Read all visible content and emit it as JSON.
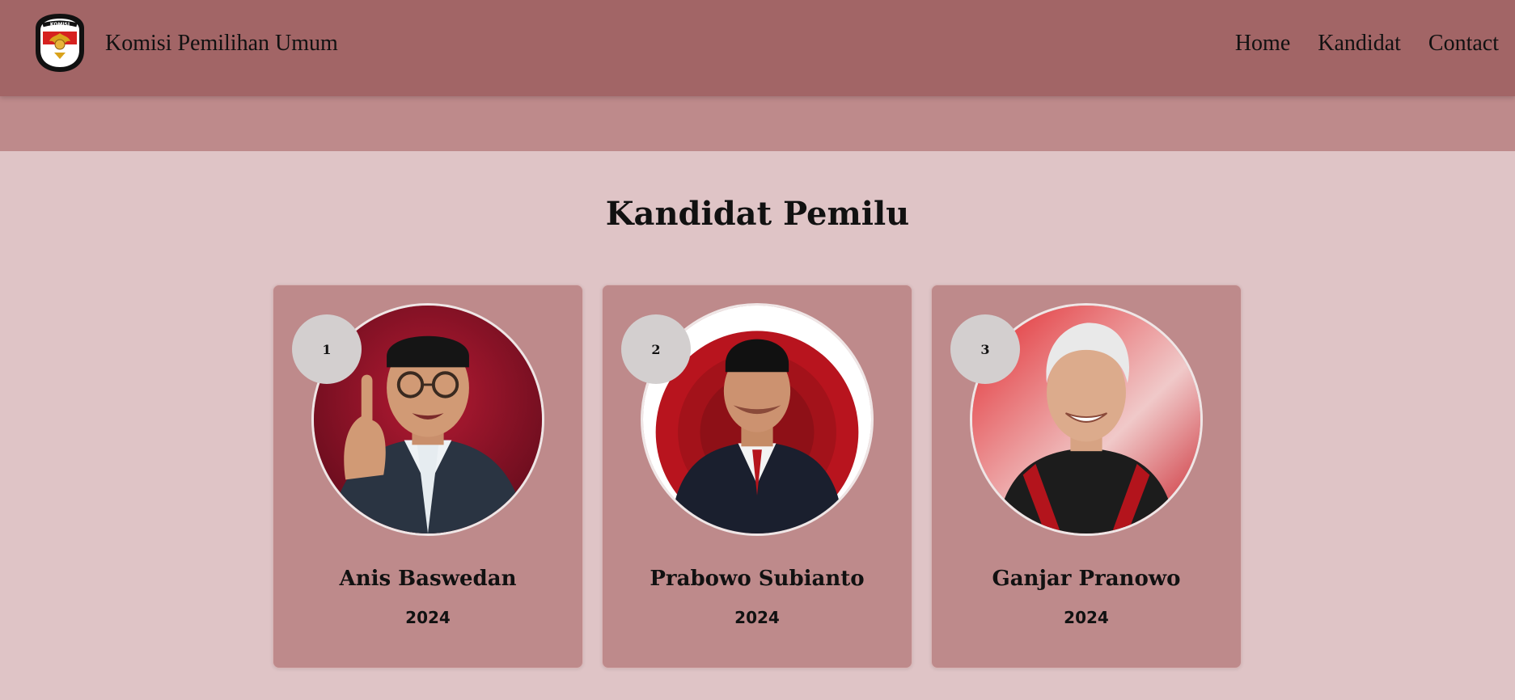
{
  "header": {
    "brand": "Komisi Pemilihan Umum",
    "logo": {
      "name": "kpu-logo",
      "top_text": "KOMISI",
      "bottom_text": "PEMILIHAN UMUM"
    },
    "nav": [
      {
        "label": "Home"
      },
      {
        "label": "Kandidat"
      },
      {
        "label": "Contact"
      }
    ]
  },
  "main": {
    "title": "Kandidat Pemilu",
    "candidates": [
      {
        "number": "1",
        "name": "Anis Baswedan",
        "year": "2024",
        "photo": "candidate-photo-anis"
      },
      {
        "number": "2",
        "name": "Prabowo Subianto",
        "year": "2024",
        "photo": "candidate-photo-prabowo"
      },
      {
        "number": "3",
        "name": "Ganjar Pranowo",
        "year": "2024",
        "photo": "candidate-photo-ganjar"
      }
    ]
  },
  "colors": {
    "navbar": "#a26566",
    "subband": "#be8a8b",
    "page_bg": "#dfc4c6",
    "card_bg": "#be8a8b",
    "badge_bg": "#d3cfcf"
  }
}
